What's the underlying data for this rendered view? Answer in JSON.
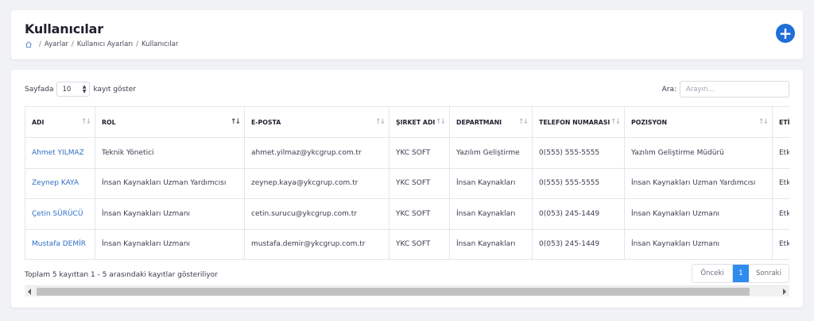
{
  "header": {
    "title": "Kullanıcılar",
    "breadcrumb": [
      "Ayarlar",
      "Kullanıcı Ayarları",
      "Kullanıcılar"
    ],
    "add_icon": "plus-circle-icon",
    "accent": "#1e6fd8"
  },
  "controls": {
    "length_prefix": "Sayfada",
    "length_value": "10",
    "length_suffix": "kayıt göster",
    "search_label": "Ara:",
    "search_placeholder": "Arayın..."
  },
  "table": {
    "columns": [
      "ADI",
      "ROL",
      "E-POSTA",
      "ŞIRKET ADI",
      "DEPARTMANI",
      "TELEFON NUMARASI",
      "POZISYON",
      "ETİKET"
    ],
    "rows": [
      [
        "Ahmet YILMAZ",
        "Teknik Yönetici",
        "ahmet.yilmaz@ykcgrup.com.tr",
        "YKC SOFT",
        "Yazılım Geliştirme",
        "0(555) 555-5555",
        "Yazılım Geliştirme Müdürü",
        "Etk"
      ],
      [
        "Zeynep KAYA",
        "İnsan Kaynakları Uzman Yardımcısı",
        "zeynep.kaya@ykcgrup.com.tr",
        "YKC SOFT",
        "İnsan Kaynakları",
        "0(555) 555-5555",
        "İnsan Kaynakları Uzman Yardımcısı",
        "Etk"
      ],
      [
        "Çetin SÜRÜCÜ",
        "İnsan Kaynakları Uzmanı",
        "cetin.surucu@ykcgrup.com.tr",
        "YKC SOFT",
        "İnsan Kaynakları",
        "0(053) 245-1449",
        "İnsan Kaynakları Uzmanı",
        "Etk"
      ],
      [
        "Mustafa DEMİR",
        "İnsan Kaynakları Uzmanı",
        "mustafa.demir@ykcgrup.com.tr",
        "YKC SOFT",
        "İnsan Kaynakları",
        "0(053) 245-1449",
        "İnsan Kaynakları Uzmanı",
        "Etk"
      ]
    ]
  },
  "footer": {
    "info": "Toplam 5 kayıttan 1 - 5 arasındaki kayıtlar gösteriliyor",
    "prev": "Önceki",
    "current_page": "1",
    "next": "Sonraki"
  }
}
